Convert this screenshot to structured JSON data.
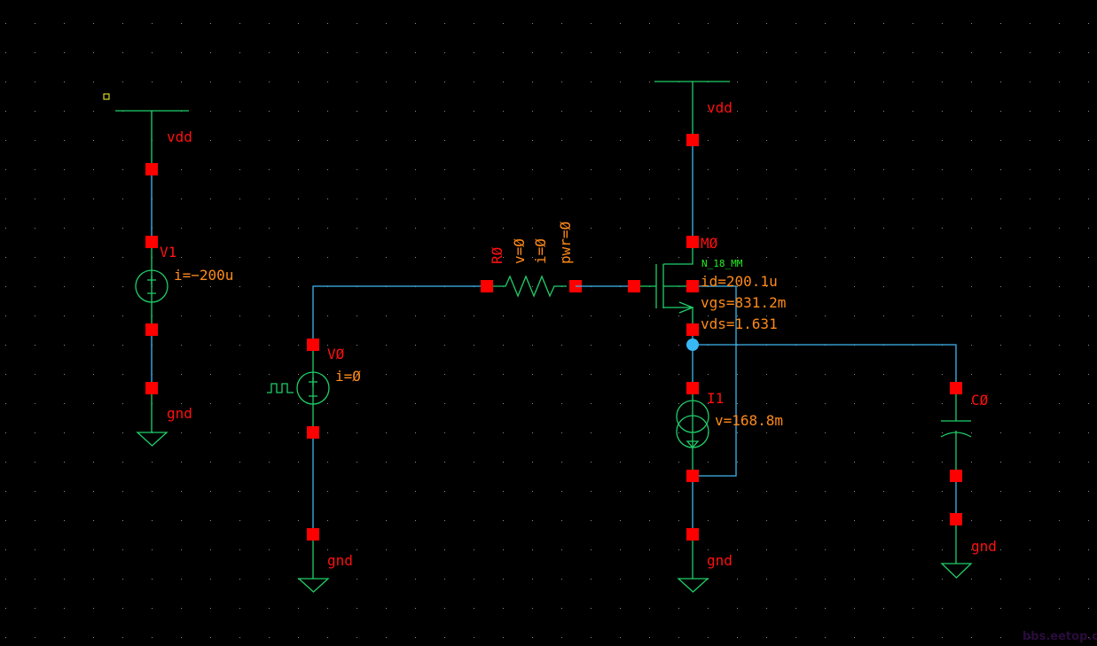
{
  "colors": {
    "background": "#000000",
    "wire": "#3fb6f0",
    "symbol": "#1fcf6a",
    "pin": "#ff0000",
    "label": "#ff1010",
    "annotation": "#ff8a1a",
    "model": "#22ee22"
  },
  "components": {
    "V1": {
      "name": "V1",
      "annotation": "i=−200u",
      "supply": "vdd",
      "ground": "gnd"
    },
    "V0": {
      "name": "VØ",
      "annotation": "i=Ø",
      "ground": "gnd"
    },
    "R0": {
      "name": "RØ",
      "v": "v=Ø",
      "i": "i=Ø",
      "pwr": "pwr=Ø"
    },
    "M0": {
      "name": "MØ",
      "model": "N_18_MM",
      "id": "id=200.1u",
      "vgs": "vgs=831.2m",
      "vds": "vds=1.631",
      "supply": "vdd"
    },
    "I1": {
      "name": "I1",
      "annotation": "v=168.8m",
      "ground": "gnd"
    },
    "C0": {
      "name": "CØ",
      "ground": "gnd"
    }
  },
  "watermark": "bbs.eetop.cn"
}
